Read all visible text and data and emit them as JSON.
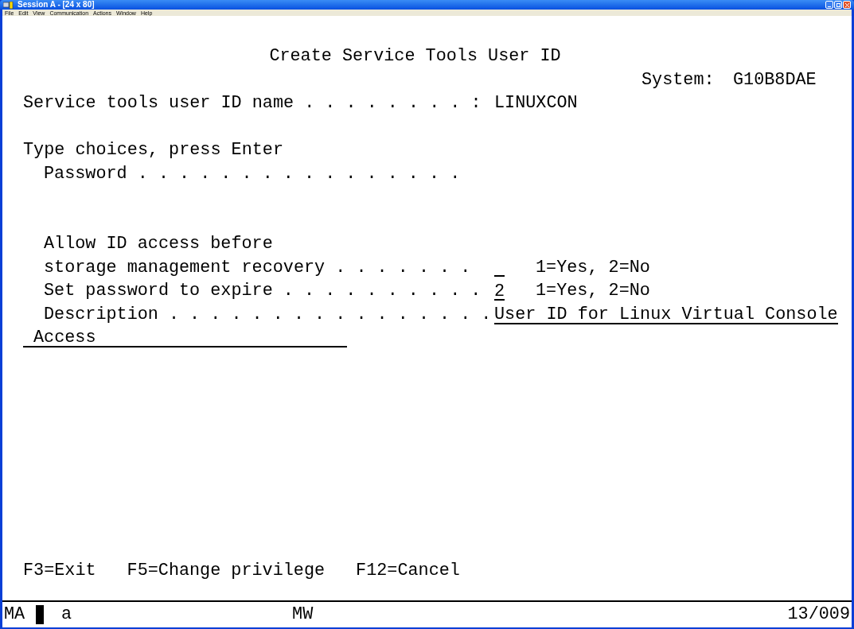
{
  "window": {
    "title": "Session A - [24 x 80]"
  },
  "menu": [
    "File",
    "Edit",
    "View",
    "Communication",
    "Actions",
    "Window",
    "Help"
  ],
  "screen": {
    "title": "Create Service Tools User ID",
    "system": {
      "label": "System:",
      "value": "G10B8DAE"
    },
    "user_id": {
      "label": "Service tools user ID name . . . . . . . . :",
      "value": "LINUXCON"
    },
    "instruction": "Type choices, press Enter",
    "fields": [
      {
        "kind": "password",
        "label_lines": [
          "Password . . . . . . . . . . . . . . . ."
        ]
      },
      {
        "kind": "choice",
        "label_lines": [
          "Allow ID access before",
          "storage management recovery . . . . . . ."
        ],
        "hint": "1=Yes, 2=No"
      },
      {
        "kind": "choice",
        "label_lines": [
          "Set password to expire . . . . . . . . . ."
        ],
        "value": "2",
        "hint": "1=Yes, 2=No"
      },
      {
        "kind": "text",
        "label_lines": [
          "Description . . . . . . . . . . . . . . . ."
        ],
        "value_lines": [
          "User ID for Linux Virtual Console",
          "Access"
        ]
      }
    ],
    "function_keys": [
      "F3=Exit",
      "F5=Change privilege",
      "F12=Cancel"
    ]
  },
  "status_bar": {
    "mode": "MA",
    "input": "a",
    "indicator": "MW",
    "cursor_position": "13/009"
  }
}
